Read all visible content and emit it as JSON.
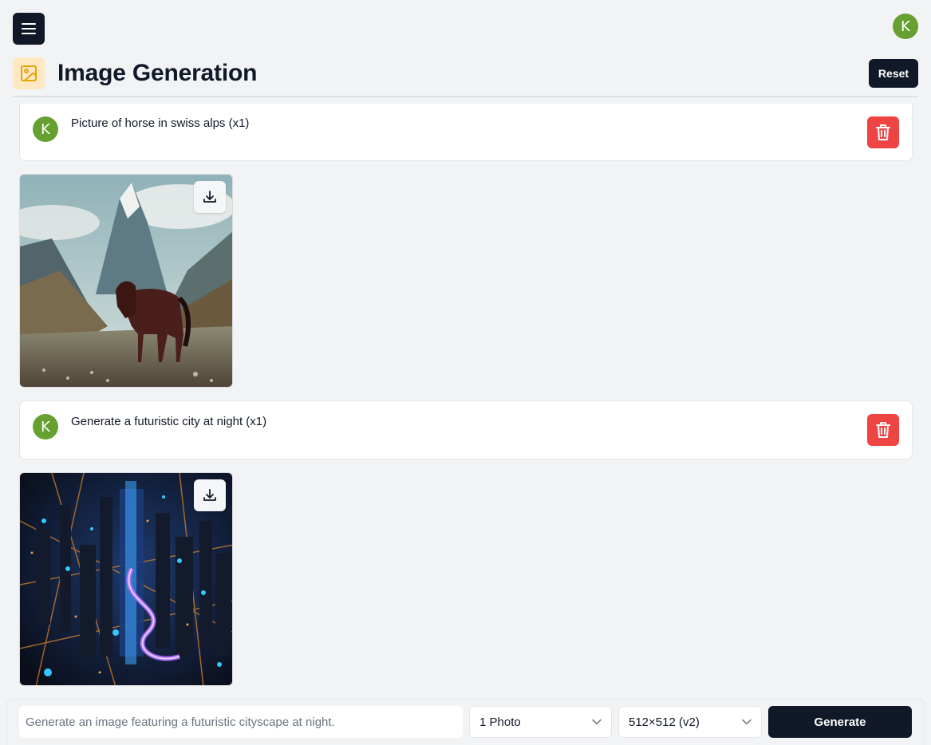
{
  "header": {
    "title": "Image Generation",
    "reset_label": "Reset",
    "user_initial": "K"
  },
  "messages": [
    {
      "initial": "K",
      "text": "Picture of horse in swiss alps (x1)"
    },
    {
      "initial": "K",
      "text": "Generate a futuristic city at night (x1)"
    }
  ],
  "composer": {
    "placeholder": "Generate an image featuring a futuristic cityscape at night.",
    "count_value": "1 Photo",
    "size_value": "512×512 (v2)",
    "generate_label": "Generate"
  },
  "colors": {
    "accent_dark": "#111827",
    "avatar_green": "#65a030",
    "delete_red": "#ef4444",
    "title_icon_bg": "#fde8c2"
  }
}
